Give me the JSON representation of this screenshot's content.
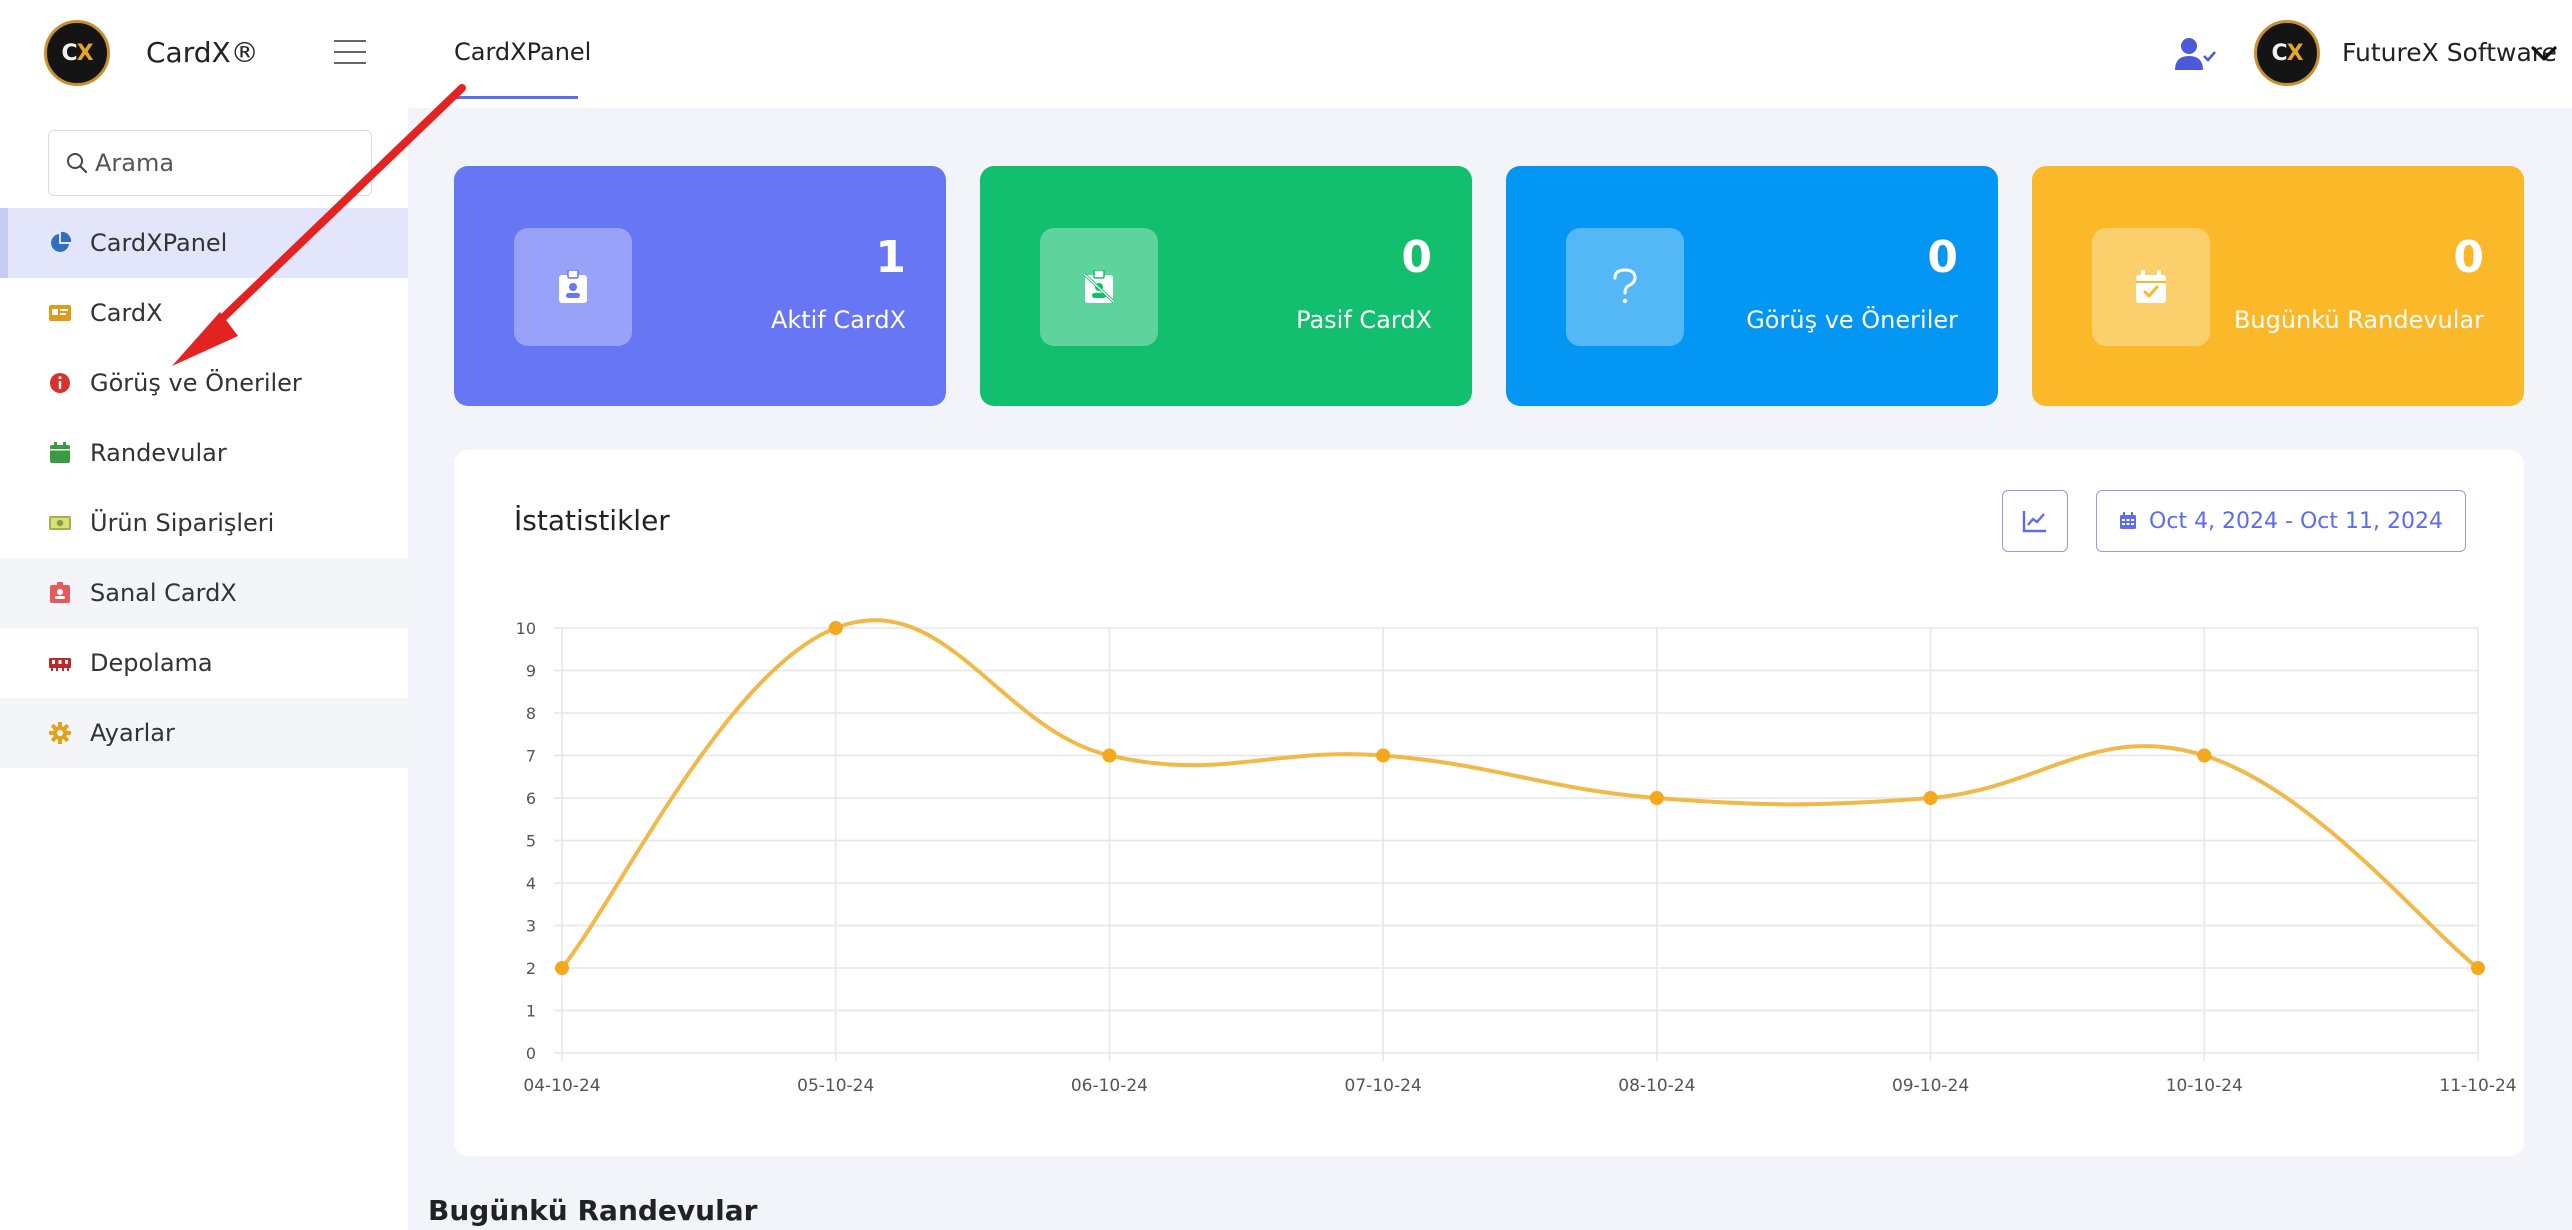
{
  "brand": {
    "name": "CardX®",
    "logo_text": "CX"
  },
  "search": {
    "placeholder": "Arama"
  },
  "sidebar": {
    "items": [
      {
        "label": "CardXPanel",
        "icon": "pie-chart-icon",
        "color": "#2f6fbf"
      },
      {
        "label": "CardX",
        "icon": "id-card-icon",
        "color": "#e39a1b"
      },
      {
        "label": "Görüş ve Öneriler",
        "icon": "info-circle-icon",
        "color": "#d9322b"
      },
      {
        "label": "Randevular",
        "icon": "calendar-icon",
        "color": "#3c9a43"
      },
      {
        "label": "Ürün Siparişleri",
        "icon": "money-icon",
        "color": "#8a9a3a"
      },
      {
        "label": "Sanal CardX",
        "icon": "badge-icon",
        "color": "#e35a5a"
      },
      {
        "label": "Depolama",
        "icon": "memory-icon",
        "color": "#c2262a"
      },
      {
        "label": "Ayarlar",
        "icon": "gear-icon",
        "color": "#e3a21b"
      }
    ]
  },
  "topbar": {
    "breadcrumb": "CardXPanel",
    "user_name": "FutureX Software"
  },
  "cards": [
    {
      "value": "1",
      "label": "Aktif CardX",
      "color": "#6776f5",
      "icon": "id-badge-icon"
    },
    {
      "value": "0",
      "label": "Pasif CardX",
      "color": "#12bf6f",
      "icon": "id-badge-off-icon"
    },
    {
      "value": "0",
      "label": "Görüş ve Öneriler",
      "color": "#0396f2",
      "icon": "question-icon"
    },
    {
      "value": "0",
      "label": "Bugünkü Randevular",
      "color": "#fbb829",
      "icon": "calendar-check-icon"
    }
  ],
  "stats": {
    "title": "İstatistikler",
    "date_range": "Oct 4, 2024 - Oct 11, 2024"
  },
  "chart_data": {
    "type": "line",
    "x": [
      "04-10-24",
      "05-10-24",
      "06-10-24",
      "07-10-24",
      "08-10-24",
      "09-10-24",
      "10-10-24",
      "11-10-24"
    ],
    "series": [
      {
        "values": [
          2,
          10,
          7,
          7,
          6,
          6,
          7,
          2
        ]
      }
    ],
    "ylim": [
      0,
      10
    ],
    "yticks": [
      0,
      1,
      2,
      3,
      4,
      5,
      6,
      7,
      8,
      9,
      10
    ],
    "grid": true,
    "line_color": "#f0b94a",
    "point_color": "#f4a81c",
    "smooth": true
  },
  "section": {
    "title": "Bugünkü Randevular"
  },
  "annotation_color": "#e52222"
}
